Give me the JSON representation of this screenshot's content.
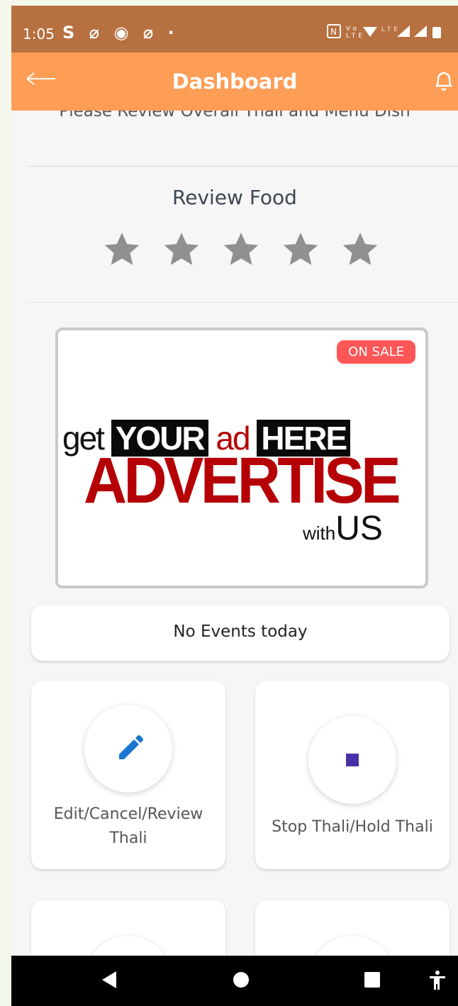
{
  "status": {
    "time": "1:05",
    "left_icons": "S ⌀ ◉ ⌀ ·",
    "right_icons": "NFC VoLTE wifi LTE signal signal battery"
  },
  "appbar": {
    "title": "Dashboard",
    "back_icon": "arrow-left-icon",
    "notification_icon": "bell-icon"
  },
  "review": {
    "cut_text": "Please Review Overall Thali and Menu Dish",
    "heading": "Review Food",
    "rating": 0,
    "max_stars": 5,
    "star_color": "#909090"
  },
  "ad": {
    "badge": "ON SALE",
    "line1_get": "get",
    "line1_your": "YOUR",
    "line1_ad": "ad",
    "line1_here": "HERE",
    "line2": "ADVERTISE",
    "line3_with": "with",
    "line3_us": "US",
    "brand_red": "#b50005",
    "badge_color": "#fd5657"
  },
  "events": {
    "text": "No Events today"
  },
  "tiles": [
    {
      "label": "Edit/Cancel/Review Thali",
      "icon": "pencil-icon",
      "icon_color": "#1976d2"
    },
    {
      "label": "Stop Thali/Hold Thali",
      "icon": "stop-icon",
      "icon_color": "#4a2fa6"
    }
  ],
  "colors": {
    "appbar": "#fd9d56",
    "statusbar": "#b7703f"
  },
  "navbar": {
    "icons": [
      "back-triangle-icon",
      "home-circle-icon",
      "recents-square-icon",
      "accessibility-icon"
    ]
  }
}
